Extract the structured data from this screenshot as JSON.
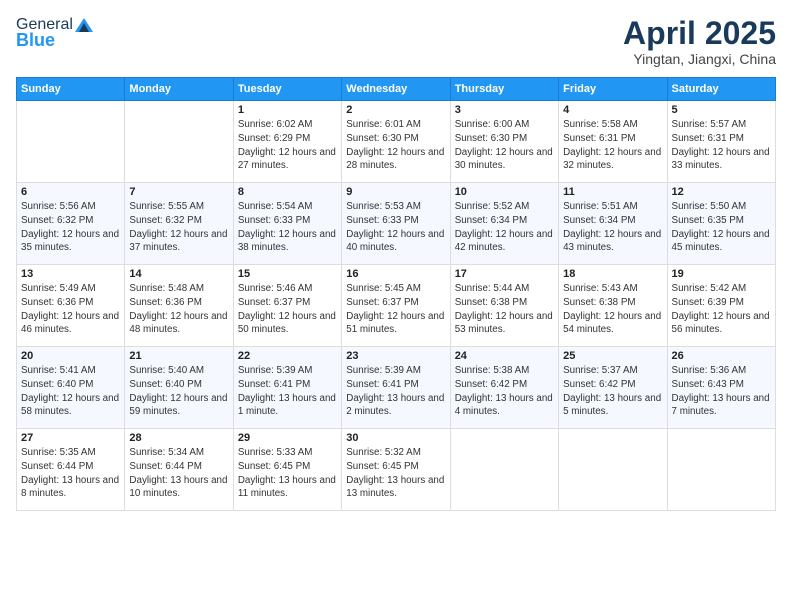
{
  "header": {
    "logo_general": "General",
    "logo_blue": "Blue",
    "month_title": "April 2025",
    "location": "Yingtan, Jiangxi, China"
  },
  "weekdays": [
    "Sunday",
    "Monday",
    "Tuesday",
    "Wednesday",
    "Thursday",
    "Friday",
    "Saturday"
  ],
  "weeks": [
    [
      {
        "day": "",
        "info": ""
      },
      {
        "day": "",
        "info": ""
      },
      {
        "day": "1",
        "info": "Sunrise: 6:02 AM\nSunset: 6:29 PM\nDaylight: 12 hours and 27 minutes."
      },
      {
        "day": "2",
        "info": "Sunrise: 6:01 AM\nSunset: 6:30 PM\nDaylight: 12 hours and 28 minutes."
      },
      {
        "day": "3",
        "info": "Sunrise: 6:00 AM\nSunset: 6:30 PM\nDaylight: 12 hours and 30 minutes."
      },
      {
        "day": "4",
        "info": "Sunrise: 5:58 AM\nSunset: 6:31 PM\nDaylight: 12 hours and 32 minutes."
      },
      {
        "day": "5",
        "info": "Sunrise: 5:57 AM\nSunset: 6:31 PM\nDaylight: 12 hours and 33 minutes."
      }
    ],
    [
      {
        "day": "6",
        "info": "Sunrise: 5:56 AM\nSunset: 6:32 PM\nDaylight: 12 hours and 35 minutes."
      },
      {
        "day": "7",
        "info": "Sunrise: 5:55 AM\nSunset: 6:32 PM\nDaylight: 12 hours and 37 minutes."
      },
      {
        "day": "8",
        "info": "Sunrise: 5:54 AM\nSunset: 6:33 PM\nDaylight: 12 hours and 38 minutes."
      },
      {
        "day": "9",
        "info": "Sunrise: 5:53 AM\nSunset: 6:33 PM\nDaylight: 12 hours and 40 minutes."
      },
      {
        "day": "10",
        "info": "Sunrise: 5:52 AM\nSunset: 6:34 PM\nDaylight: 12 hours and 42 minutes."
      },
      {
        "day": "11",
        "info": "Sunrise: 5:51 AM\nSunset: 6:34 PM\nDaylight: 12 hours and 43 minutes."
      },
      {
        "day": "12",
        "info": "Sunrise: 5:50 AM\nSunset: 6:35 PM\nDaylight: 12 hours and 45 minutes."
      }
    ],
    [
      {
        "day": "13",
        "info": "Sunrise: 5:49 AM\nSunset: 6:36 PM\nDaylight: 12 hours and 46 minutes."
      },
      {
        "day": "14",
        "info": "Sunrise: 5:48 AM\nSunset: 6:36 PM\nDaylight: 12 hours and 48 minutes."
      },
      {
        "day": "15",
        "info": "Sunrise: 5:46 AM\nSunset: 6:37 PM\nDaylight: 12 hours and 50 minutes."
      },
      {
        "day": "16",
        "info": "Sunrise: 5:45 AM\nSunset: 6:37 PM\nDaylight: 12 hours and 51 minutes."
      },
      {
        "day": "17",
        "info": "Sunrise: 5:44 AM\nSunset: 6:38 PM\nDaylight: 12 hours and 53 minutes."
      },
      {
        "day": "18",
        "info": "Sunrise: 5:43 AM\nSunset: 6:38 PM\nDaylight: 12 hours and 54 minutes."
      },
      {
        "day": "19",
        "info": "Sunrise: 5:42 AM\nSunset: 6:39 PM\nDaylight: 12 hours and 56 minutes."
      }
    ],
    [
      {
        "day": "20",
        "info": "Sunrise: 5:41 AM\nSunset: 6:40 PM\nDaylight: 12 hours and 58 minutes."
      },
      {
        "day": "21",
        "info": "Sunrise: 5:40 AM\nSunset: 6:40 PM\nDaylight: 12 hours and 59 minutes."
      },
      {
        "day": "22",
        "info": "Sunrise: 5:39 AM\nSunset: 6:41 PM\nDaylight: 13 hours and 1 minute."
      },
      {
        "day": "23",
        "info": "Sunrise: 5:39 AM\nSunset: 6:41 PM\nDaylight: 13 hours and 2 minutes."
      },
      {
        "day": "24",
        "info": "Sunrise: 5:38 AM\nSunset: 6:42 PM\nDaylight: 13 hours and 4 minutes."
      },
      {
        "day": "25",
        "info": "Sunrise: 5:37 AM\nSunset: 6:42 PM\nDaylight: 13 hours and 5 minutes."
      },
      {
        "day": "26",
        "info": "Sunrise: 5:36 AM\nSunset: 6:43 PM\nDaylight: 13 hours and 7 minutes."
      }
    ],
    [
      {
        "day": "27",
        "info": "Sunrise: 5:35 AM\nSunset: 6:44 PM\nDaylight: 13 hours and 8 minutes."
      },
      {
        "day": "28",
        "info": "Sunrise: 5:34 AM\nSunset: 6:44 PM\nDaylight: 13 hours and 10 minutes."
      },
      {
        "day": "29",
        "info": "Sunrise: 5:33 AM\nSunset: 6:45 PM\nDaylight: 13 hours and 11 minutes."
      },
      {
        "day": "30",
        "info": "Sunrise: 5:32 AM\nSunset: 6:45 PM\nDaylight: 13 hours and 13 minutes."
      },
      {
        "day": "",
        "info": ""
      },
      {
        "day": "",
        "info": ""
      },
      {
        "day": "",
        "info": ""
      }
    ]
  ]
}
